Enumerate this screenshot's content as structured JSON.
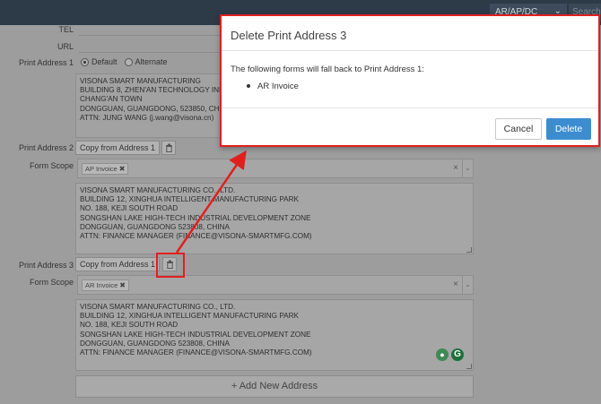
{
  "topbar": {
    "company": "AR/AP/DC",
    "search_placeholder": "Search"
  },
  "form": {
    "tel_label": "TEL",
    "url_label": "URL",
    "print_address_1": {
      "label": "Print Address 1",
      "radio_default": "Default",
      "radio_alternate": "Alternate",
      "address": "VISONA SMART MANUFACTURING\nBUILDING 8, ZHEN'AN TECHNOLOGY INDUSTRIAL PARK\nCHANG'AN TOWN\nDONGGUAN, GUANGDONG, 523850, CHINA\nATTN: JUNG WANG (j.wang@visona.cn)"
    },
    "print_address_2": {
      "label": "Print Address 2",
      "copy_button": "Copy from Address 1",
      "form_scope_label": "Form Scope",
      "scope_tag": "AP Invoice",
      "address": "VISONA SMART MANUFACTURING CO., LTD.\nBUILDING 12, XINGHUA INTELLIGENT MANUFACTURING PARK\nNO. 188, KEJI SOUTH ROAD\nSONGSHAN LAKE HIGH-TECH INDUSTRIAL DEVELOPMENT ZONE\nDONGGUAN, GUANGDONG 523808, CHINA\nATTN: FINANCE MANAGER (FINANCE@VISONA-SMARTMFG.COM)"
    },
    "print_address_3": {
      "label": "Print Address 3",
      "copy_button": "Copy from Address 1",
      "form_scope_label": "Form Scope",
      "scope_tag": "AR Invoice",
      "address": "VISONA SMART MANUFACTURING CO., LTD.\nBUILDING 12, XINGHUA INTELLIGENT MANUFACTURING PARK\nNO. 188, KEJI SOUTH ROAD\nSONGSHAN LAKE HIGH-TECH INDUSTRIAL DEVELOPMENT ZONE\nDONGGUAN, GUANGDONG 523808, CHINA\nATTN: FINANCE MANAGER (FINANCE@VISONA-SMARTMFG.COM)"
    },
    "add_new_address": "+ Add New Address"
  },
  "modal": {
    "title": "Delete Print Address 3",
    "message": "The following forms will fall back to Print Address 1:",
    "items": [
      "AR Invoice"
    ],
    "cancel_label": "Cancel",
    "delete_label": "Delete"
  },
  "colors": {
    "topbar": "#2d3a48",
    "overlay_bg": "#9d9d9d",
    "annotation": "#e0201f",
    "primary": "#3c8dd0"
  },
  "icons": {
    "trash": "trash-icon",
    "chevron": "chevron-down-icon",
    "clear": "clear-icon"
  }
}
